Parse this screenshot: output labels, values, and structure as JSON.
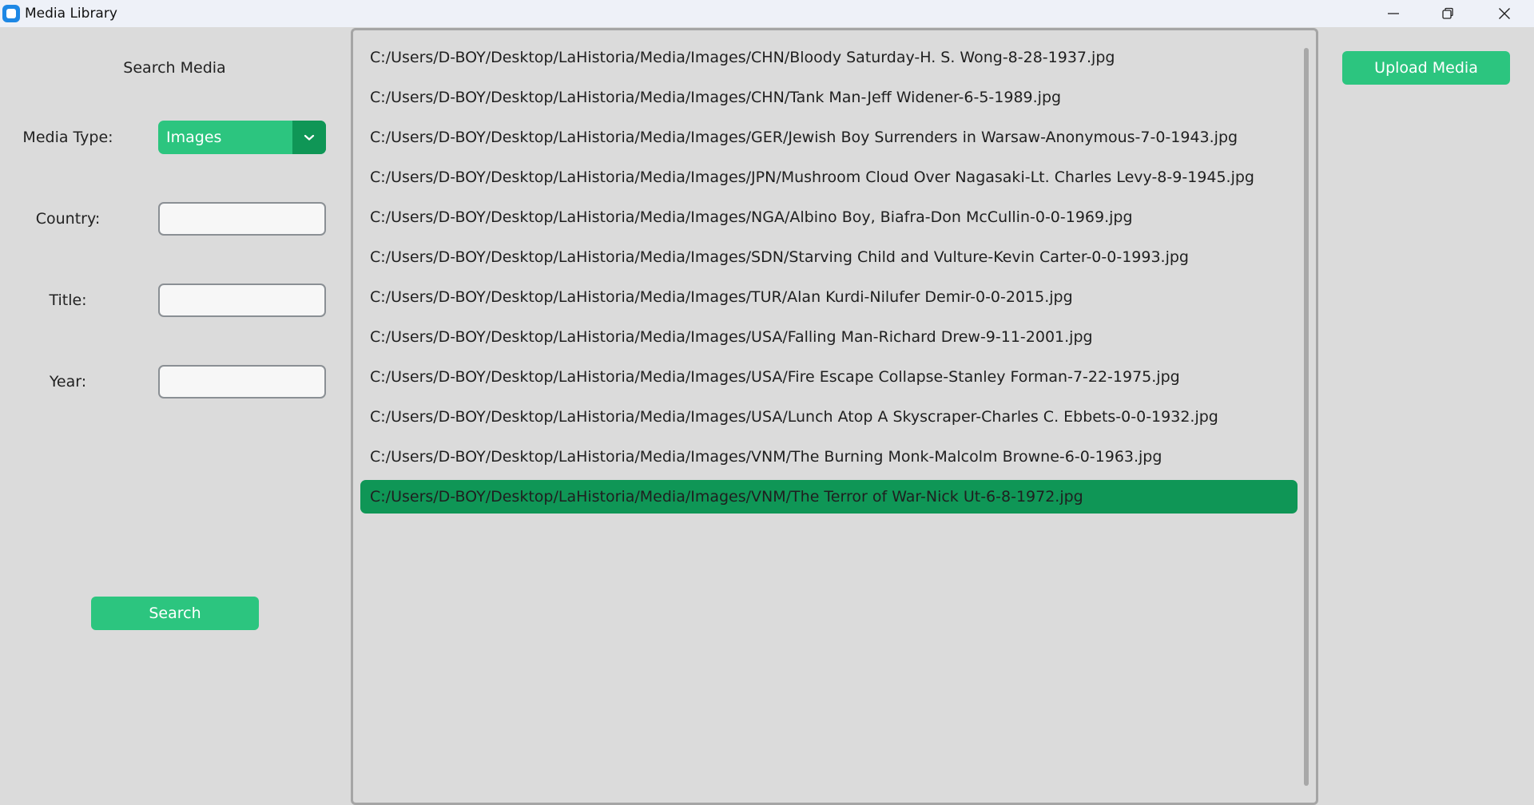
{
  "window": {
    "title": "Media Library"
  },
  "colors": {
    "accent": "#2cc57f",
    "accent_dark": "#0f9656",
    "background": "#dbdbdb"
  },
  "search_panel": {
    "heading": "Search Media",
    "media_type_label": "Media Type:",
    "media_type_value": "Images",
    "country_label": "Country:",
    "country_value": "",
    "title_label": "Title:",
    "title_value": "",
    "year_label": "Year:",
    "year_value": "",
    "search_button": "Search"
  },
  "upload_button": "Upload Media",
  "media_list": {
    "items": [
      "C:/Users/D-BOY/Desktop/LaHistoria/Media/Images/CHN/Bloody Saturday-H. S. Wong-8-28-1937.jpg",
      "C:/Users/D-BOY/Desktop/LaHistoria/Media/Images/CHN/Tank Man-Jeff Widener-6-5-1989.jpg",
      "C:/Users/D-BOY/Desktop/LaHistoria/Media/Images/GER/Jewish Boy Surrenders in Warsaw-Anonymous-7-0-1943.jpg",
      "C:/Users/D-BOY/Desktop/LaHistoria/Media/Images/JPN/Mushroom Cloud Over Nagasaki-Lt. Charles Levy-8-9-1945.jpg",
      "C:/Users/D-BOY/Desktop/LaHistoria/Media/Images/NGA/Albino Boy, Biafra-Don McCullin-0-0-1969.jpg",
      "C:/Users/D-BOY/Desktop/LaHistoria/Media/Images/SDN/Starving Child and Vulture-Kevin Carter-0-0-1993.jpg",
      "C:/Users/D-BOY/Desktop/LaHistoria/Media/Images/TUR/Alan Kurdi-Nilufer Demir-0-0-2015.jpg",
      "C:/Users/D-BOY/Desktop/LaHistoria/Media/Images/USA/Falling Man-Richard Drew-9-11-2001.jpg",
      "C:/Users/D-BOY/Desktop/LaHistoria/Media/Images/USA/Fire Escape Collapse-Stanley Forman-7-22-1975.jpg",
      "C:/Users/D-BOY/Desktop/LaHistoria/Media/Images/USA/Lunch Atop A Skyscraper-Charles C. Ebbets-0-0-1932.jpg",
      "C:/Users/D-BOY/Desktop/LaHistoria/Media/Images/VNM/The Burning Monk-Malcolm Browne-6-0-1963.jpg",
      "C:/Users/D-BOY/Desktop/LaHistoria/Media/Images/VNM/The Terror of War-Nick Ut-6-8-1972.jpg"
    ],
    "selected_index": 11
  }
}
